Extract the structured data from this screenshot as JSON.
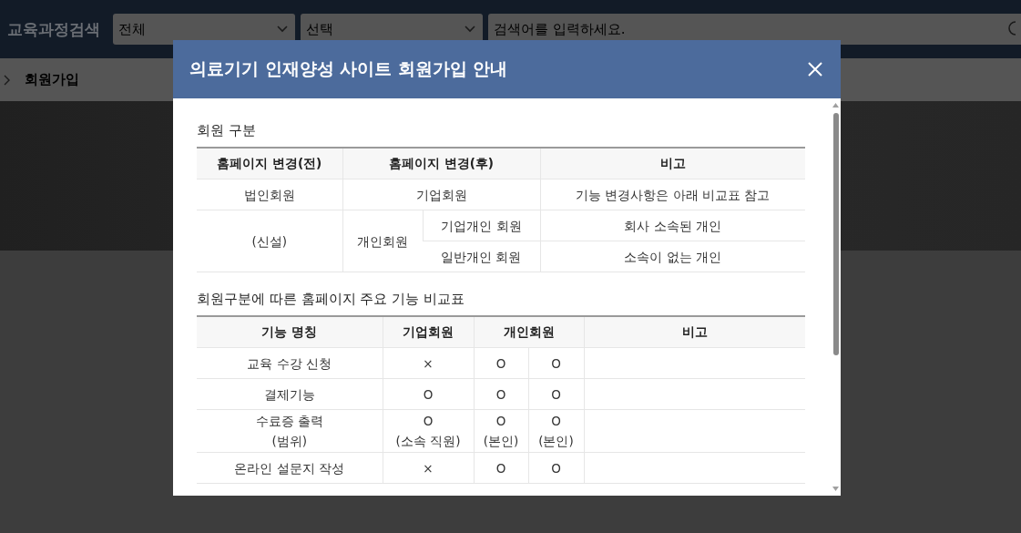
{
  "header": {
    "title": "교육과정검색",
    "category_select": "전체",
    "sub_select": "선택",
    "search": {
      "placeholder": "검색어를 입력하세요."
    }
  },
  "breadcrumb": {
    "current": "회원가입"
  },
  "modal": {
    "title": "의료기기 인재양성 사이트 회원가입 안내",
    "membership_section": {
      "title": "회원 구분",
      "columns": [
        "홈페이지 변경(전)",
        "홈페이지 변경(후)",
        "비고"
      ],
      "rows": [
        {
          "before": "법인회원",
          "after": "기업회원",
          "note": "기능 변경사항은 아래 비교표 참고"
        },
        {
          "before": "(신설)",
          "after": "개인회원",
          "subtypes": [
            {
              "name": "기업개인 회원",
              "note": "회사 소속된 개인"
            },
            {
              "name": "일반개인 회원",
              "note": "소속이 없는 개인"
            }
          ]
        }
      ]
    },
    "feature_section": {
      "title": "회원구분에 따른 홈페이지 주요 기능 비교표",
      "columns": [
        "기능 명칭",
        "기업회원",
        "개인회원",
        "비고"
      ],
      "rows": [
        {
          "feature": "교육 수강 신청",
          "corporate": "×",
          "individual": [
            "O",
            "O"
          ]
        },
        {
          "feature": "결제기능",
          "corporate": "O",
          "individual": [
            "O",
            "O"
          ]
        },
        {
          "feature": "수료증 출력\n(범위)",
          "corporate": "O\n(소속 직원)",
          "individual": [
            "O\n(본인)",
            "O\n(본인)"
          ]
        },
        {
          "feature": "온라인 설문지 작성",
          "corporate": "×",
          "individual": [
            "O",
            "O"
          ]
        }
      ]
    }
  }
}
